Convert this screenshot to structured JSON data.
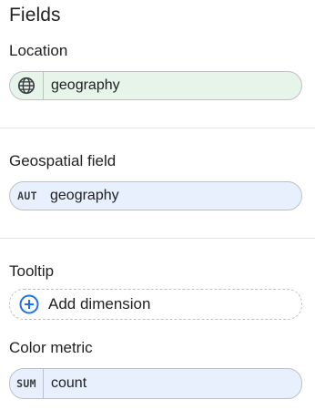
{
  "panel": {
    "title": "Fields"
  },
  "location": {
    "label": "Location",
    "icon": "globe-icon",
    "value": "geography",
    "color": "#e6f4ea"
  },
  "geospatial": {
    "label": "Geospatial field",
    "type_tag": "AUT",
    "value": "geography",
    "color": "#e8f0fe"
  },
  "tooltip": {
    "label": "Tooltip",
    "icon": "add-circle-icon",
    "action": "Add dimension",
    "accent": "#1a73e8"
  },
  "color_metric": {
    "label": "Color metric",
    "type_tag": "SUM",
    "value": "count",
    "color": "#e8f0fe"
  }
}
